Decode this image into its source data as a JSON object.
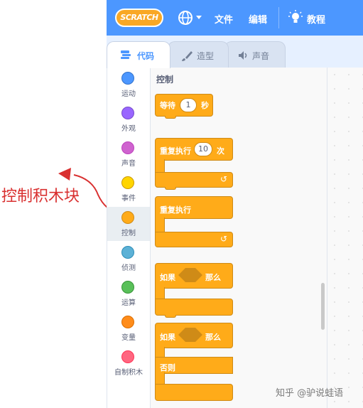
{
  "menubar": {
    "logo_text": "SCRATCH",
    "file": "文件",
    "edit": "编辑",
    "tutorials": "教程"
  },
  "tabs": [
    {
      "label": "代码",
      "icon": "code-icon",
      "active": true
    },
    {
      "label": "造型",
      "icon": "brush-icon",
      "active": false
    },
    {
      "label": "声音",
      "icon": "speaker-icon",
      "active": false
    }
  ],
  "annotation": {
    "label": "控制积木块",
    "color": "#d93030"
  },
  "categories": [
    {
      "label": "运动",
      "color": "#4c97ff"
    },
    {
      "label": "外观",
      "color": "#9966ff"
    },
    {
      "label": "声音",
      "color": "#cf63cf"
    },
    {
      "label": "事件",
      "color": "#ffd500"
    },
    {
      "label": "控制",
      "color": "#ffab19",
      "selected": true
    },
    {
      "label": "侦测",
      "color": "#5cb1d6"
    },
    {
      "label": "运算",
      "color": "#59c059"
    },
    {
      "label": "变量",
      "color": "#ff8c1a"
    },
    {
      "label": "自制积木",
      "color": "#ff6680"
    }
  ],
  "palette": {
    "title": "控制",
    "blocks": {
      "wait": {
        "prefix": "等待",
        "value": "1",
        "suffix": "秒"
      },
      "repeat": {
        "prefix": "重复执行",
        "value": "10",
        "suffix": "次"
      },
      "forever": {
        "label": "重复执行"
      },
      "if_then": {
        "prefix": "如果",
        "suffix": "那么"
      },
      "if_else": {
        "prefix": "如果",
        "suffix": "那么",
        "else_label": "否则"
      }
    }
  },
  "watermark": "知乎 @驴说蛙语",
  "colors": {
    "menubar": "#4c97ff",
    "control_block": "#ffab19"
  }
}
